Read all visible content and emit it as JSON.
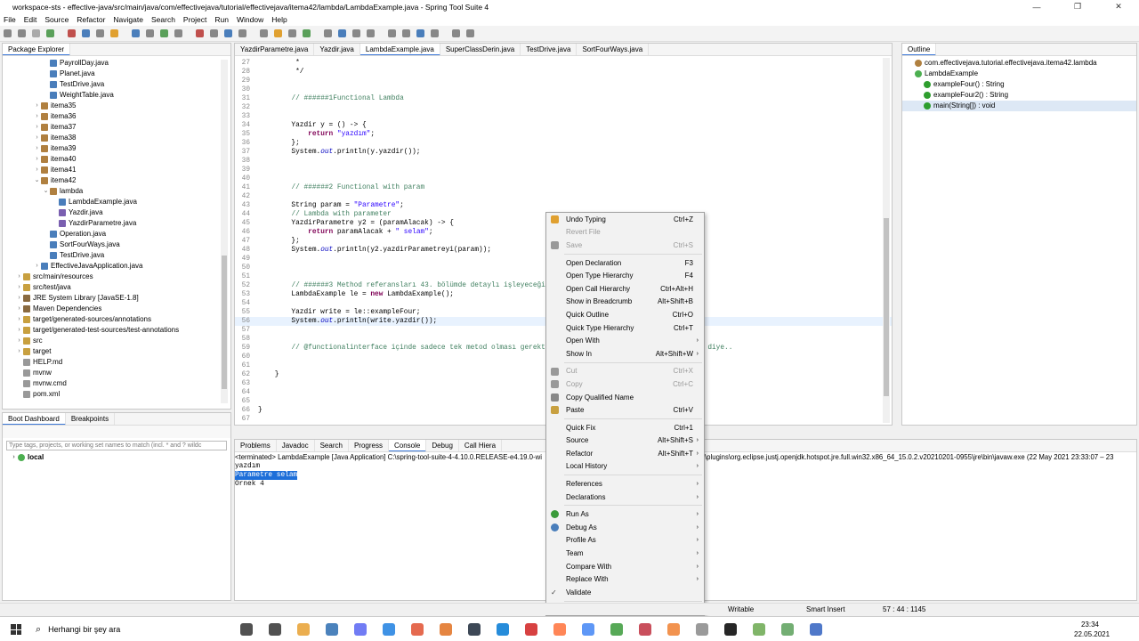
{
  "window": {
    "title": "workspace-sts - effective-java/src/main/java/com/effectivejava/tutorial/effectivejava/itema42/lambda/LambdaExample.java - Spring Tool Suite 4",
    "min": "—",
    "max": "❐",
    "close": "✕"
  },
  "menu": [
    "File",
    "Edit",
    "Source",
    "Refactor",
    "Navigate",
    "Search",
    "Project",
    "Run",
    "Window",
    "Help"
  ],
  "package_explorer": {
    "title": "Package Explorer",
    "items": [
      {
        "label": "PayrollDay.java",
        "indent": 4,
        "kind": "java"
      },
      {
        "label": "Planet.java",
        "indent": 4,
        "kind": "java"
      },
      {
        "label": "TestDrive.java",
        "indent": 4,
        "kind": "java"
      },
      {
        "label": "WeightTable.java",
        "indent": 4,
        "kind": "java"
      },
      {
        "label": "itema35",
        "indent": 3,
        "kind": "pkg"
      },
      {
        "label": "itema36",
        "indent": 3,
        "kind": "pkg"
      },
      {
        "label": "itema37",
        "indent": 3,
        "kind": "pkg"
      },
      {
        "label": "itema38",
        "indent": 3,
        "kind": "pkg"
      },
      {
        "label": "itema39",
        "indent": 3,
        "kind": "pkg"
      },
      {
        "label": "itema40",
        "indent": 3,
        "kind": "pkg"
      },
      {
        "label": "itema41",
        "indent": 3,
        "kind": "pkg"
      },
      {
        "label": "itema42",
        "indent": 3,
        "kind": "pkg",
        "open": true
      },
      {
        "label": "lambda",
        "indent": 4,
        "kind": "pkg",
        "open": true
      },
      {
        "label": "LambdaExample.java",
        "indent": 5,
        "kind": "java"
      },
      {
        "label": "Yazdir.java",
        "indent": 5,
        "kind": "iface"
      },
      {
        "label": "YazdirParametre.java",
        "indent": 5,
        "kind": "iface"
      },
      {
        "label": "Operation.java",
        "indent": 4,
        "kind": "java"
      },
      {
        "label": "SortFourWays.java",
        "indent": 4,
        "kind": "java"
      },
      {
        "label": "TestDrive.java",
        "indent": 4,
        "kind": "java"
      },
      {
        "label": "EffectiveJavaApplication.java",
        "indent": 3,
        "kind": "java"
      },
      {
        "label": "src/main/resources",
        "indent": 1,
        "kind": "folder"
      },
      {
        "label": "src/test/java",
        "indent": 1,
        "kind": "folder"
      },
      {
        "label": "JRE System Library [JavaSE-1.8]",
        "indent": 1,
        "kind": "lib"
      },
      {
        "label": "Maven Dependencies",
        "indent": 1,
        "kind": "lib"
      },
      {
        "label": "target/generated-sources/annotations",
        "indent": 1,
        "kind": "folder"
      },
      {
        "label": "target/generated-test-sources/test-annotations",
        "indent": 1,
        "kind": "folder"
      },
      {
        "label": "src",
        "indent": 1,
        "kind": "folder"
      },
      {
        "label": "target",
        "indent": 1,
        "kind": "folder"
      },
      {
        "label": "HELP.md",
        "indent": 1,
        "kind": "file"
      },
      {
        "label": "mvnw",
        "indent": 1,
        "kind": "file"
      },
      {
        "label": "mvnw.cmd",
        "indent": 1,
        "kind": "file"
      },
      {
        "label": "pom.xml",
        "indent": 1,
        "kind": "file"
      }
    ]
  },
  "boot_dashboard": {
    "tabs": [
      "Boot Dashboard",
      "Breakpoints"
    ],
    "filter_placeholder": "Type tags, projects, or working set names to match (incl. * and ? wildc",
    "local": "local"
  },
  "editor": {
    "tabs": [
      "YazdirParametre.java",
      "Yazdir.java",
      "LambdaExample.java",
      "SuperClassDerin.java",
      "TestDrive.java",
      "SortFourWays.java"
    ],
    "active_tab": 2,
    "lines": [
      {
        "n": "27",
        "t": "         *"
      },
      {
        "n": "28",
        "t": "         */"
      },
      {
        "n": "29",
        "t": ""
      },
      {
        "n": "30",
        "t": ""
      },
      {
        "n": "31",
        "t": "        // ######1Functional Lambda"
      },
      {
        "n": "32",
        "t": ""
      },
      {
        "n": "33",
        "t": ""
      },
      {
        "n": "34",
        "t": "        Yazdir y = () -> {"
      },
      {
        "n": "35",
        "t": "            return \"yazdım\";"
      },
      {
        "n": "36",
        "t": "        };"
      },
      {
        "n": "37",
        "t": "        System.out.println(y.yazdir());"
      },
      {
        "n": "38",
        "t": ""
      },
      {
        "n": "39",
        "t": ""
      },
      {
        "n": "40",
        "t": ""
      },
      {
        "n": "41",
        "t": "        // ######2 Functional with param"
      },
      {
        "n": "42",
        "t": ""
      },
      {
        "n": "43",
        "t": "        String param = \"Parametre\";"
      },
      {
        "n": "44",
        "t": "        // Lambda with parameter"
      },
      {
        "n": "45",
        "t": "        YazdirParametre y2 = (paramAlacak) -> {"
      },
      {
        "n": "46",
        "t": "            return paramAlacak + \" selam\";"
      },
      {
        "n": "47",
        "t": "        };"
      },
      {
        "n": "48",
        "t": "        System.out.println(y2.yazdirParametreyi(param));"
      },
      {
        "n": "49",
        "t": ""
      },
      {
        "n": "50",
        "t": ""
      },
      {
        "n": "51",
        "t": ""
      },
      {
        "n": "52",
        "t": "        // ######3 Method referansları 43. bölümde detaylı işleyeceğiz"
      },
      {
        "n": "53",
        "t": "        LambdaExample le = new LambdaExample();"
      },
      {
        "n": "54",
        "t": ""
      },
      {
        "n": "55",
        "t": "        Yazdir write = le::exampleFour;"
      },
      {
        "n": "56",
        "t": "        System.out.println(write.yazdir());"
      },
      {
        "n": "57",
        "t": ""
      },
      {
        "n": "58",
        "t": ""
      },
      {
        "n": "59",
        "t": "        // @functionalinterface içinde sadece tek metod olması gerekt                              çıkmasın diye.."
      },
      {
        "n": "60",
        "t": ""
      },
      {
        "n": "61",
        "t": ""
      },
      {
        "n": "62",
        "t": "    }"
      },
      {
        "n": "63",
        "t": ""
      },
      {
        "n": "64",
        "t": ""
      },
      {
        "n": "65",
        "t": ""
      },
      {
        "n": "66",
        "t": "}"
      },
      {
        "n": "67",
        "t": ""
      }
    ]
  },
  "outline": {
    "title": "Outline",
    "items": [
      {
        "label": "com.effectivejava.tutorial.effectivejava.itema42.lambda",
        "indent": 1
      },
      {
        "label": "LambdaExample",
        "indent": 1
      },
      {
        "label": "exampleFour() : String",
        "indent": 2
      },
      {
        "label": "exampleFour2() : String",
        "indent": 2
      },
      {
        "label": "main(String[]) : void",
        "indent": 2
      }
    ]
  },
  "console": {
    "tabs": [
      "Problems",
      "Javadoc",
      "Search",
      "Progress",
      "Console",
      "Debug",
      "Call Hiera"
    ],
    "header": "<terminated> LambdaExample [Java Application] C:\\spring-tool-suite-4-4.10.0.RELEASE-e4.19.0-wi",
    "header_right": "\\plugins\\org.eclipse.justj.openjdk.hotspot.jre.full.win32.x86_64_15.0.2.v20210201-0955\\jre\\bin\\javaw.exe  (22 May 2021 23:33:07 – 23",
    "lines": [
      "yazdım",
      "Parametre selam",
      "Ornek 4"
    ]
  },
  "context_menu": [
    {
      "label": "Undo Typing",
      "sc": "Ctrl+Z",
      "icon": "undo-icon"
    },
    {
      "label": "Revert File",
      "dis": true
    },
    {
      "label": "Save",
      "sc": "Ctrl+S",
      "dis": true,
      "icon": "save-icon"
    },
    {
      "sep": true
    },
    {
      "label": "Open Declaration",
      "sc": "F3"
    },
    {
      "label": "Open Type Hierarchy",
      "sc": "F4"
    },
    {
      "label": "Open Call Hierarchy",
      "sc": "Ctrl+Alt+H"
    },
    {
      "label": "Show in Breadcrumb",
      "sc": "Alt+Shift+B"
    },
    {
      "label": "Quick Outline",
      "sc": "Ctrl+O"
    },
    {
      "label": "Quick Type Hierarchy",
      "sc": "Ctrl+T"
    },
    {
      "label": "Open With",
      "sub": true
    },
    {
      "label": "Show In",
      "sc": "Alt+Shift+W",
      "sub": true
    },
    {
      "sep": true
    },
    {
      "label": "Cut",
      "sc": "Ctrl+X",
      "dis": true,
      "icon": "cut-icon"
    },
    {
      "label": "Copy",
      "sc": "Ctrl+C",
      "dis": true,
      "icon": "copy-icon"
    },
    {
      "label": "Copy Qualified Name",
      "icon": "copy-qualified-icon"
    },
    {
      "label": "Paste",
      "sc": "Ctrl+V",
      "icon": "paste-icon"
    },
    {
      "sep": true
    },
    {
      "label": "Quick Fix",
      "sc": "Ctrl+1"
    },
    {
      "label": "Source",
      "sc": "Alt+Shift+S",
      "sub": true
    },
    {
      "label": "Refactor",
      "sc": "Alt+Shift+T",
      "sub": true
    },
    {
      "label": "Local History",
      "sub": true
    },
    {
      "sep": true
    },
    {
      "label": "References",
      "sub": true
    },
    {
      "label": "Declarations",
      "sub": true
    },
    {
      "sep": true
    },
    {
      "label": "Run As",
      "sub": true,
      "icon": "run-icon"
    },
    {
      "label": "Debug As",
      "sub": true,
      "icon": "debug-icon"
    },
    {
      "label": "Profile As",
      "sub": true
    },
    {
      "label": "Team",
      "sub": true
    },
    {
      "label": "Compare With",
      "sub": true
    },
    {
      "label": "Replace With",
      "sub": true
    },
    {
      "label": "Validate",
      "check": true
    },
    {
      "sep": true
    },
    {
      "label": "Preferences..."
    }
  ],
  "status": {
    "writable": "Writable",
    "insert": "Smart Insert",
    "pos": "57 : 44 : 1145"
  },
  "taskbar": {
    "search": "Herhangi bir şey ara",
    "time": "23:34",
    "date": "22.05.2021"
  }
}
